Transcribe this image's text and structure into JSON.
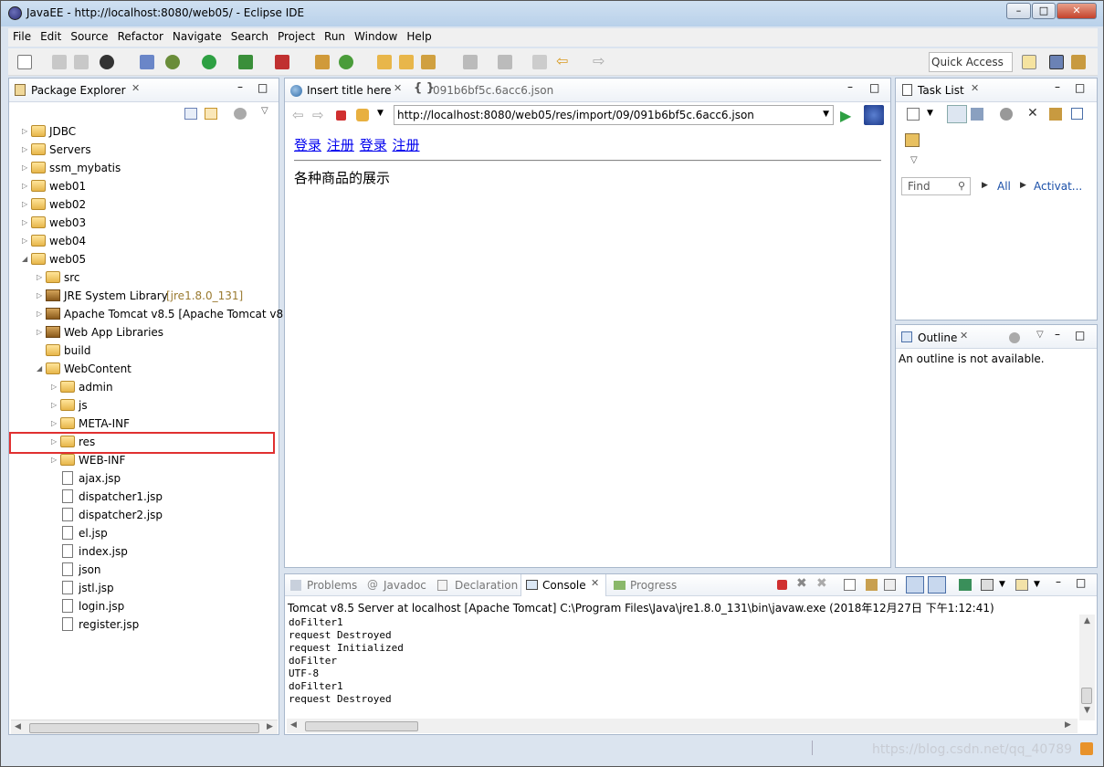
{
  "window": {
    "title": "JavaEE - http://localhost:8080/web05/ - Eclipse IDE"
  },
  "menu": [
    "File",
    "Edit",
    "Source",
    "Refactor",
    "Navigate",
    "Search",
    "Project",
    "Run",
    "Window",
    "Help"
  ],
  "quick_access": "Quick Access",
  "package_explorer": {
    "tab": "Package Explorer",
    "items": [
      {
        "label": "JDBC",
        "depth": 0,
        "expand": "closed",
        "icon": "project-icon"
      },
      {
        "label": "Servers",
        "depth": 0,
        "expand": "closed",
        "icon": "folder-icon"
      },
      {
        "label": "ssm_mybatis",
        "depth": 0,
        "expand": "closed",
        "icon": "project-icon"
      },
      {
        "label": "web01",
        "depth": 0,
        "expand": "closed",
        "icon": "project-icon"
      },
      {
        "label": "web02",
        "depth": 0,
        "expand": "closed",
        "icon": "project-icon"
      },
      {
        "label": "web03",
        "depth": 0,
        "expand": "closed",
        "icon": "project-icon"
      },
      {
        "label": "web04",
        "depth": 0,
        "expand": "closed",
        "icon": "project-icon"
      },
      {
        "label": "web05",
        "depth": 0,
        "expand": "open",
        "icon": "project-icon"
      },
      {
        "label": "src",
        "depth": 1,
        "expand": "closed",
        "icon": "package-folder-icon"
      },
      {
        "label": "JRE System Library",
        "suffix": "[jre1.8.0_131]",
        "depth": 1,
        "expand": "closed",
        "icon": "library-icon"
      },
      {
        "label": "Apache Tomcat v8.5 [Apache Tomcat v8.",
        "depth": 1,
        "expand": "closed",
        "icon": "library-icon"
      },
      {
        "label": "Web App Libraries",
        "depth": 1,
        "expand": "closed",
        "icon": "library-icon"
      },
      {
        "label": "build",
        "depth": 1,
        "expand": "none",
        "icon": "folder-icon"
      },
      {
        "label": "WebContent",
        "depth": 1,
        "expand": "open",
        "icon": "folder-icon"
      },
      {
        "label": "admin",
        "depth": 2,
        "expand": "closed",
        "icon": "folder-icon"
      },
      {
        "label": "js",
        "depth": 2,
        "expand": "closed",
        "icon": "folder-icon"
      },
      {
        "label": "META-INF",
        "depth": 2,
        "expand": "closed",
        "icon": "folder-icon"
      },
      {
        "label": "res",
        "depth": 2,
        "expand": "closed",
        "icon": "folder-icon",
        "highlight": true
      },
      {
        "label": "WEB-INF",
        "depth": 2,
        "expand": "closed",
        "icon": "folder-icon"
      },
      {
        "label": "ajax.jsp",
        "depth": 2,
        "expand": "none",
        "icon": "file-icon"
      },
      {
        "label": "dispatcher1.jsp",
        "depth": 2,
        "expand": "none",
        "icon": "file-icon"
      },
      {
        "label": "dispatcher2.jsp",
        "depth": 2,
        "expand": "none",
        "icon": "file-icon"
      },
      {
        "label": "el.jsp",
        "depth": 2,
        "expand": "none",
        "icon": "file-icon"
      },
      {
        "label": "index.jsp",
        "depth": 2,
        "expand": "none",
        "icon": "file-icon"
      },
      {
        "label": "json",
        "depth": 2,
        "expand": "none",
        "icon": "file-icon"
      },
      {
        "label": "jstl.jsp",
        "depth": 2,
        "expand": "none",
        "icon": "file-icon"
      },
      {
        "label": "login.jsp",
        "depth": 2,
        "expand": "none",
        "icon": "file-icon"
      },
      {
        "label": "register.jsp",
        "depth": 2,
        "expand": "none",
        "icon": "file-icon"
      }
    ]
  },
  "editor": {
    "tabs": [
      "Insert title here",
      "091b6bf5c.6acc6.json"
    ],
    "url": "http://localhost:8080/web05/res/import/09/091b6bf5c.6acc6.json",
    "links": [
      "登录",
      "注册",
      "登录",
      "注册"
    ],
    "body_text": "各种商品的展示"
  },
  "task_list": {
    "tab": "Task List",
    "find_placeholder": "Find",
    "all": "All",
    "activate": "Activat..."
  },
  "outline": {
    "tab": "Outline",
    "message": "An outline is not available."
  },
  "bottom": {
    "tabs": [
      "Problems",
      "Javadoc",
      "Declaration",
      "Console",
      "Progress"
    ],
    "active_tab": "Console",
    "console_header": "Tomcat v8.5 Server at localhost [Apache Tomcat] C:\\Program Files\\Java\\jre1.8.0_131\\bin\\javaw.exe (2018年12月27日 下午1:12:41)",
    "lines": [
      "doFilter1",
      "request Destroyed",
      "request Initialized",
      "doFilter",
      "UTF-8",
      "doFilter1",
      "request Destroyed"
    ]
  },
  "watermark": "https://blog.csdn.net/qq_40789"
}
